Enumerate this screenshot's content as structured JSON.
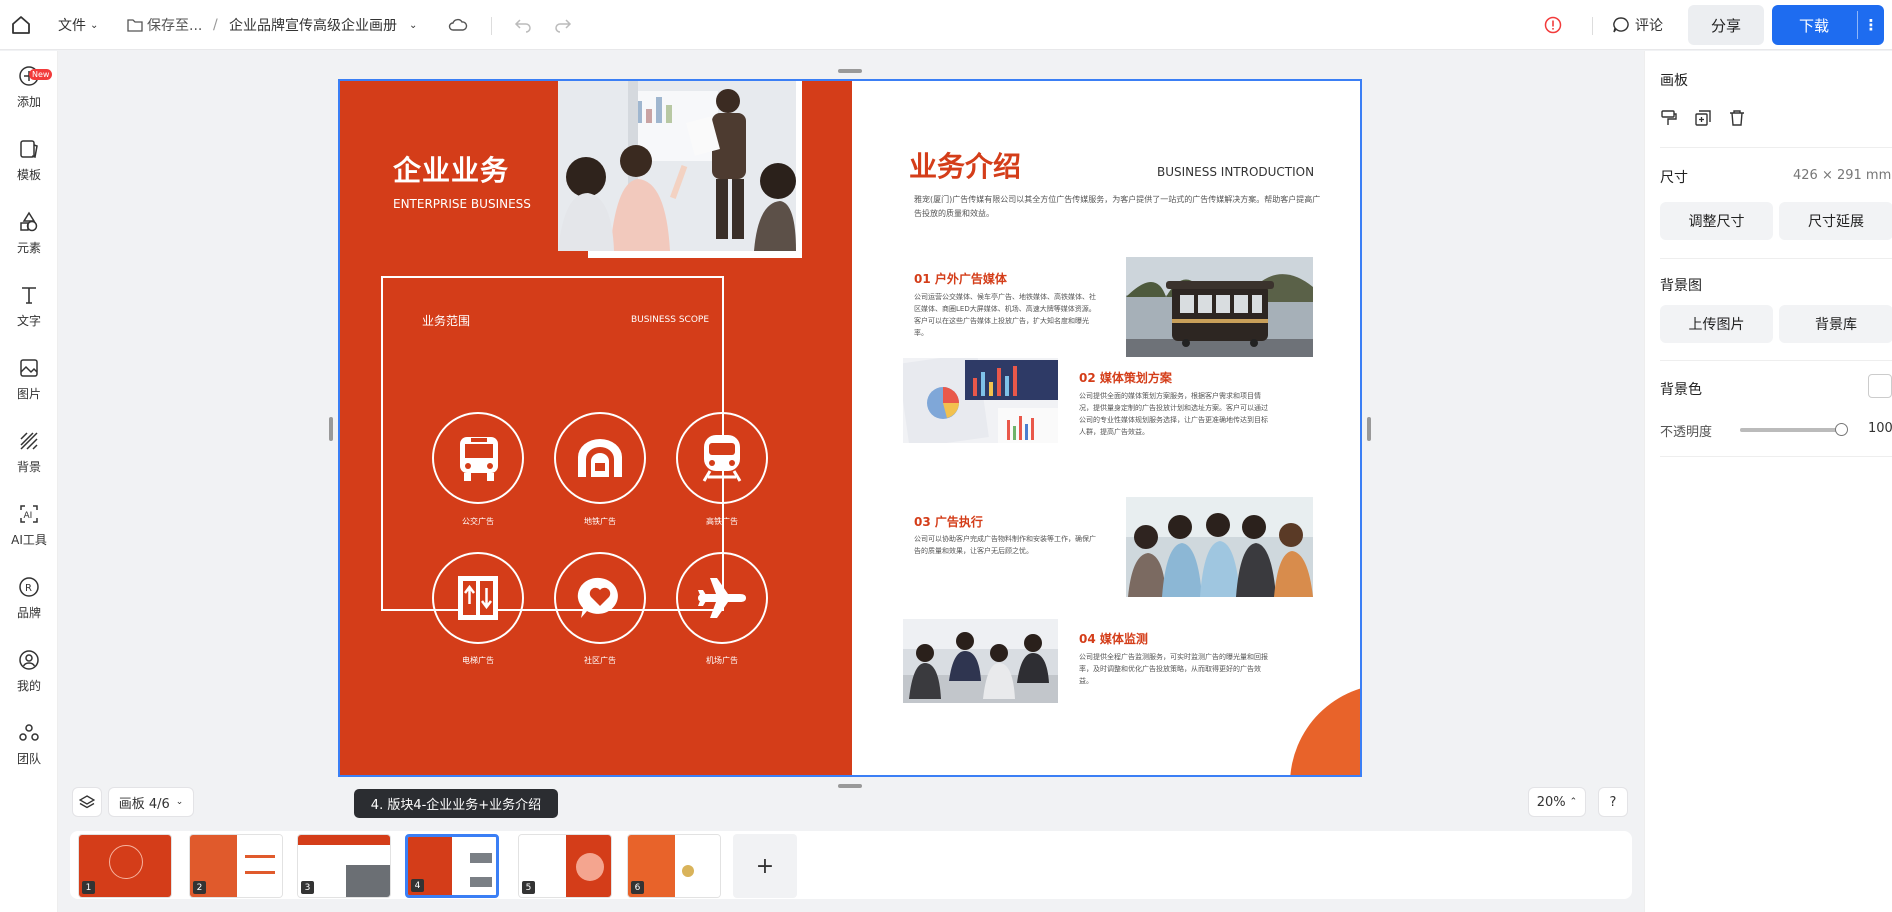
{
  "topbar": {
    "file_menu": "文件",
    "save_status": "保存至...",
    "breadcrumb_sep": "/",
    "doc_title": "企业品牌宣传高级企业画册",
    "comment": "评论",
    "share": "分享",
    "download": "下载",
    "more": "⋮"
  },
  "sidebar": {
    "badge": "New",
    "items": [
      {
        "label": "添加",
        "icon": "add-icon"
      },
      {
        "label": "模板",
        "icon": "template-icon"
      },
      {
        "label": "元素",
        "icon": "elements-icon"
      },
      {
        "label": "文字",
        "icon": "text-icon"
      },
      {
        "label": "图片",
        "icon": "image-icon"
      },
      {
        "label": "背景",
        "icon": "background-icon"
      },
      {
        "label": "AI工具",
        "icon": "ai-tools-icon"
      },
      {
        "label": "品牌",
        "icon": "brand-icon"
      },
      {
        "label": "我的",
        "icon": "user-icon"
      },
      {
        "label": "团队",
        "icon": "team-icon"
      }
    ]
  },
  "panel": {
    "title": "画板",
    "size_label": "尺寸",
    "size_value": "426 × 291 mm",
    "resize": "调整尺寸",
    "extend": "尺寸延展",
    "bg_image_label": "背景图",
    "upload": "上传图片",
    "bg_library": "背景库",
    "bg_color_label": "背景色",
    "bg_color": "#ffffff",
    "opacity_label": "不透明度",
    "opacity_value": "100",
    "opacity_fraction": 1.0
  },
  "design": {
    "left_title": "企业业务",
    "left_subtitle": "ENTERPRISE BUSINESS",
    "scope_title": "业务范围",
    "scope_en": "BUSINESS SCOPE",
    "scope_items": [
      "公交广告",
      "地铁广告",
      "高铁广告",
      "电梯广告",
      "社区广告",
      "机场广告"
    ],
    "right_title": "业务介绍",
    "right_en": "BUSINESS INTRODUCTION",
    "intro": "雅宠(厦门)广告传媒有限公司以其全方位广告传媒服务，为客户提供了一站式的广告传媒解决方案。帮助客户提高广告投放的质量和效益。",
    "sections": [
      {
        "title": "01 户外广告媒体",
        "text": "公司运营公交媒体、候车亭广告、地铁媒体、高铁媒体、社区媒体、商圈LED大屏媒体、机场、高速大牌等媒体资源。客户可以在这些广告媒体上投放广告，扩大知名度和曝光率。"
      },
      {
        "title": "02 媒体策划方案",
        "text": "公司提供全面的媒体策划方案服务，根据客户需求和项目情况，提供量身定制的广告投放计划和选址方案。客户可以通过公司的专业性媒体规划服务选择，让广告更准确地传达到目标人群，提高广告效益。"
      },
      {
        "title": "03 广告执行",
        "text": "公司可以协助客户完成广告物料制作和安装等工作，确保广告的质量和效果，让客户无后顾之忧。"
      },
      {
        "title": "04 媒体监测",
        "text": "公司提供全程广告监测服务，可实时监测广告的曝光量和回报率，及时调整和优化广告投放策略，从而取得更好的广告效益。"
      }
    ]
  },
  "bottom": {
    "board_indicator": "画板 4/6",
    "tooltip": "4. 版块4-企业业务+业务介绍",
    "zoom": "20%",
    "help": "?",
    "add": "+",
    "thumbs": [
      "1",
      "2",
      "3",
      "4",
      "5",
      "6"
    ]
  },
  "colors": {
    "accent": "#1e6cf0",
    "brand_red": "#d43d19",
    "orange": "#e8632a"
  }
}
